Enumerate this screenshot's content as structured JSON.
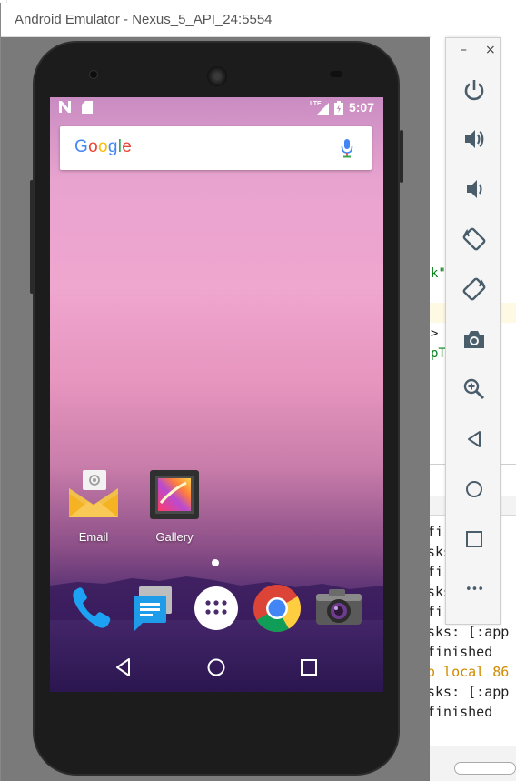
{
  "emulator": {
    "title": "Android Emulator - Nexus_5_API_24:5554"
  },
  "statusbar": {
    "network_label": "LTE",
    "time": "5:07"
  },
  "search": {
    "logo_text": "Google"
  },
  "apps": [
    {
      "label": "Email",
      "icon": "email-icon"
    },
    {
      "label": "Gallery",
      "icon": "gallery-icon"
    }
  ],
  "dock": [
    {
      "icon": "phone-icon"
    },
    {
      "icon": "messages-icon"
    },
    {
      "icon": "app-drawer-icon"
    },
    {
      "icon": "chrome-icon"
    },
    {
      "icon": "camera-icon"
    }
  ],
  "navbar": {
    "back": "back-icon",
    "home": "home-icon",
    "recents": "recents-icon"
  },
  "control_panel": {
    "minimize": "–",
    "close": "×",
    "more": "•••",
    "buttons": [
      "power-icon",
      "volume-up-icon",
      "volume-down-icon",
      "rotate-left-icon",
      "rotate-right-icon",
      "screenshot-icon",
      "zoom-icon",
      "back-icon",
      "home-icon",
      "overview-icon",
      "more-icon"
    ]
  },
  "ide": {
    "frag_1": "k\"",
    "frag_2": ">",
    "frag_3": "pT",
    "logs": [
      "fi",
      "sks",
      "fi",
      "sks",
      "fi",
      "sks: [:app",
      "finished",
      "o local 86",
      "sks: [:app",
      "finished"
    ]
  },
  "colors": {
    "accent_blue": "#4285F4",
    "accent_red": "#EA4335",
    "accent_yellow": "#FBBC05",
    "accent_green": "#34A853"
  }
}
